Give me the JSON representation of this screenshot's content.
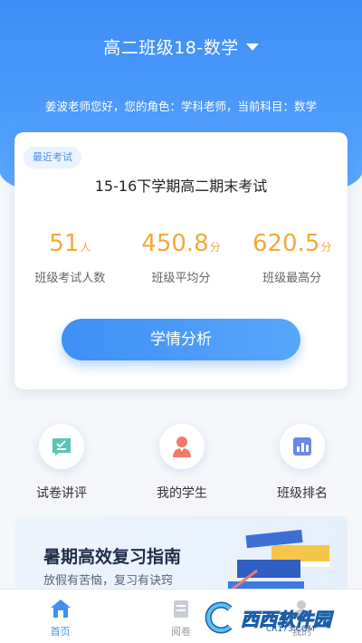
{
  "header": {
    "class_title": "高二班级18-数学",
    "greeting": "姜波老师您好，您的角色：学科老师，当前科目：数学"
  },
  "exam": {
    "tag": "最近考试",
    "name": "15-16下学期高二期末考试",
    "stats": [
      {
        "value": "51",
        "unit": "人",
        "label": "班级考试人数"
      },
      {
        "value": "450.8",
        "unit": "分",
        "label": "班级平均分"
      },
      {
        "value": "620.5",
        "unit": "分",
        "label": "班级最高分"
      }
    ],
    "analyze_label": "学情分析"
  },
  "shortcuts": [
    {
      "label": "试卷讲评",
      "icon": "paper-review-icon"
    },
    {
      "label": "我的学生",
      "icon": "student-icon"
    },
    {
      "label": "班级排名",
      "icon": "ranking-chart-icon"
    }
  ],
  "banner": {
    "title": "暑期高效复习指南",
    "subtitle": "放假有苦恼，复习有诀窍"
  },
  "tabs": [
    {
      "label": "首页",
      "icon": "home-icon",
      "active": true
    },
    {
      "label": "阅卷",
      "icon": "marking-icon",
      "active": false
    },
    {
      "label": "我的",
      "icon": "profile-icon",
      "active": false
    }
  ],
  "watermark": {
    "text": "西西软件园",
    "url": "CR173.COM"
  },
  "colors": {
    "primary": "#3f8ff6",
    "accent_orange": "#f5a83a"
  }
}
